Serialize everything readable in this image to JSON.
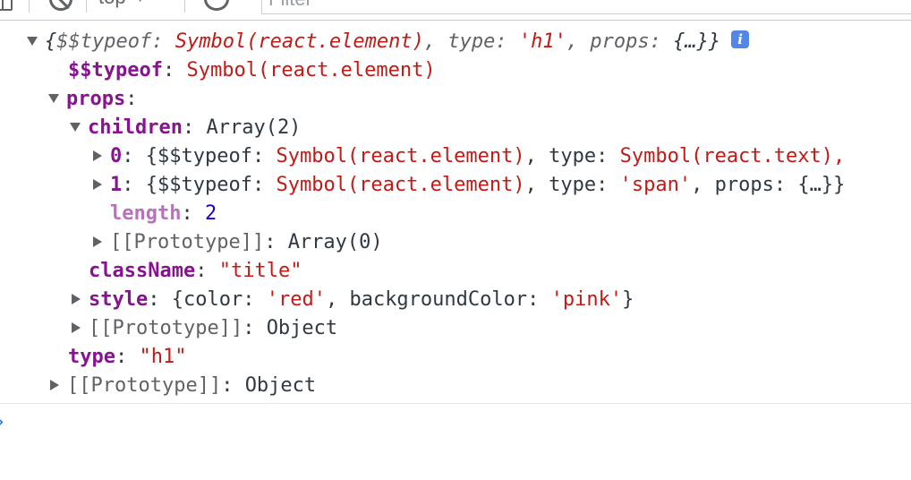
{
  "toolbar": {
    "context": "top",
    "filter_placeholder": "Filter"
  },
  "tree": {
    "root": {
      "preview_open": "{",
      "typeof_key": "$$typeof",
      "typeof_val": "Symbol(react.element)",
      "type_key": "type",
      "type_val": "'h1'",
      "props_key": "props",
      "props_val": "{…}",
      "preview_close": "}",
      "info": "i"
    },
    "typeof_row": {
      "key": "$$typeof",
      "value": "Symbol(react.element)"
    },
    "props_row": {
      "key": "props"
    },
    "children_row": {
      "key": "children",
      "value": "Array(2)"
    },
    "child0": {
      "index": "0",
      "typeof_key": "$$typeof",
      "typeof_val": "Symbol(react.element)",
      "type_key": "type",
      "type_val": "Symbol(react.text),"
    },
    "child1": {
      "index": "1",
      "typeof_key": "$$typeof",
      "typeof_val": "Symbol(react.element)",
      "type_key": "type",
      "type_val": "'span'",
      "props_key": "props",
      "props_val": "{…}}"
    },
    "length_row": {
      "key": "length",
      "value": "2"
    },
    "children_proto": {
      "key": "[[Prototype]]",
      "value": "Array(0)"
    },
    "classname_row": {
      "key": "className",
      "value": "\"title\""
    },
    "style_row": {
      "key": "style",
      "color_key": "color",
      "color_val": "'red'",
      "bg_key": "backgroundColor",
      "bg_val": "'pink'"
    },
    "props_proto": {
      "key": "[[Prototype]]",
      "value": "Object"
    },
    "type_row": {
      "key": "type",
      "value": "\"h1\""
    },
    "root_proto": {
      "key": "[[Prototype]]",
      "value": "Object"
    }
  },
  "colors": {
    "key": "#881391",
    "key_dim": "#b871bd",
    "string": "#c41a16",
    "number": "#1c00cf",
    "info_badge": "#5287e8",
    "prompt": "#1a73e8"
  }
}
